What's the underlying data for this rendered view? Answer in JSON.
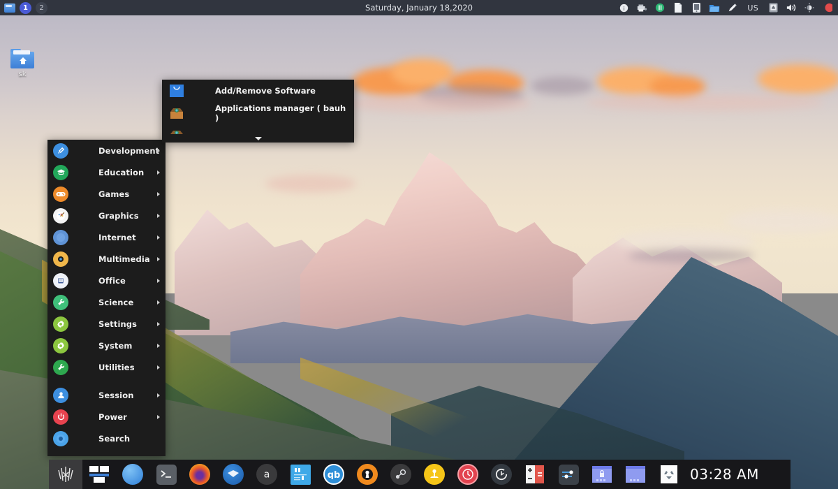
{
  "top_panel": {
    "window_button": "window-list-icon",
    "workspaces": [
      {
        "label": "1",
        "active": true
      },
      {
        "label": "2",
        "active": false
      }
    ],
    "clock": "Saturday, January 18,2020",
    "tray_icons": [
      {
        "name": "info-icon"
      },
      {
        "name": "printer-icon"
      },
      {
        "name": "music-note-icon"
      },
      {
        "name": "document-icon"
      },
      {
        "name": "device-icon"
      },
      {
        "name": "blue-folder-icon"
      },
      {
        "name": "pen-icon"
      }
    ],
    "keyboard_layout": "US",
    "tray_icons_right": [
      {
        "name": "display-icon"
      },
      {
        "name": "volume-icon"
      },
      {
        "name": "brightness-icon"
      },
      {
        "name": "notification-icon"
      }
    ]
  },
  "desktop": {
    "icons": [
      {
        "label": "sk",
        "icon": "home-folder-icon"
      }
    ]
  },
  "app_menu": {
    "categories": [
      {
        "label": "Development",
        "icon": "screwdriver-icon",
        "color": "#3d8fe0",
        "glyph": "✒",
        "arrow": true
      },
      {
        "label": "Education",
        "icon": "graduation-cap-icon",
        "color": "#22a85a",
        "glyph": "⌂",
        "arrow": true
      },
      {
        "label": "Games",
        "icon": "gamepad-icon",
        "color": "#ee8b2a",
        "glyph": "◉",
        "arrow": true
      },
      {
        "label": "Graphics",
        "icon": "palette-icon",
        "color": "#f2f2f2",
        "glyph": "◐",
        "arrow": true
      },
      {
        "label": "Internet",
        "icon": "compass-icon",
        "color": "#5f93d6",
        "glyph": "✦",
        "arrow": true
      },
      {
        "label": "Multimedia",
        "icon": "media-disc-icon",
        "color": "#f0b64a",
        "glyph": "◎",
        "arrow": true
      },
      {
        "label": "Office",
        "icon": "document-blue-icon",
        "color": "#eef1f7",
        "glyph": "▤",
        "arrow": true
      },
      {
        "label": "Science",
        "icon": "wrench-icon",
        "color": "#3fc07a",
        "glyph": "⚒",
        "arrow": true
      },
      {
        "label": "Settings",
        "icon": "gear-icon",
        "color": "#8cc63f",
        "glyph": "⚙",
        "arrow": true
      },
      {
        "label": "System",
        "icon": "gear-icon",
        "color": "#8cc63f",
        "glyph": "⚙",
        "arrow": true
      },
      {
        "label": "Utilities",
        "icon": "wrench-icon",
        "color": "#2ea84f",
        "glyph": "⚒",
        "arrow": true
      }
    ],
    "bottom_items": [
      {
        "label": "Session",
        "icon": "user-icon",
        "color": "#3d8fe0",
        "glyph": "●",
        "arrow": true
      },
      {
        "label": "Power",
        "icon": "power-icon",
        "color": "#e8434f",
        "glyph": "⏻",
        "arrow": true
      },
      {
        "label": "Search",
        "icon": "search-icon",
        "color": "#4aa3e8",
        "glyph": "●",
        "arrow": false
      }
    ]
  },
  "submenu": {
    "items": [
      {
        "label": "Add/Remove Software",
        "icon": "software-bag-icon"
      },
      {
        "label": "Applications manager ( bauh )",
        "icon": "package-box-icon"
      },
      {
        "label": "",
        "icon": "package-box-icon"
      }
    ],
    "scroll_indicator": "chevron-down-icon"
  },
  "dock": {
    "items": [
      {
        "name": "whisker-menu-icon",
        "active": true
      },
      {
        "name": "window-tiles-icon",
        "active": false
      },
      {
        "name": "browser-blue-icon",
        "active": false
      },
      {
        "name": "terminal-icon",
        "active": false
      },
      {
        "name": "firefox-icon",
        "active": false
      },
      {
        "name": "thunderbird-icon",
        "active": false
      },
      {
        "name": "audacious-icon",
        "active": false
      },
      {
        "name": "text-editor-icon",
        "active": false
      },
      {
        "name": "qbittorrent-icon",
        "active": false
      },
      {
        "name": "tor-browser-icon",
        "active": false
      },
      {
        "name": "steam-icon",
        "active": false
      },
      {
        "name": "joystick-yellow-icon",
        "active": false
      },
      {
        "name": "clock-red-icon",
        "active": false
      },
      {
        "name": "stopwatch-icon",
        "active": false
      },
      {
        "name": "calculator-icon",
        "active": false
      },
      {
        "name": "settings-sliders-icon",
        "active": false
      },
      {
        "name": "window-lock-icon",
        "active": false
      },
      {
        "name": "window-plain-icon",
        "active": false
      },
      {
        "name": "trash-icon",
        "active": false
      }
    ],
    "clock": "03:28 AM"
  },
  "colors": {
    "panel_bg": "#31353f",
    "menu_bg": "#1c1c1c",
    "dock_bg": "#17171a",
    "accent": "#4a5bd6",
    "text": "#f0f0f0"
  }
}
